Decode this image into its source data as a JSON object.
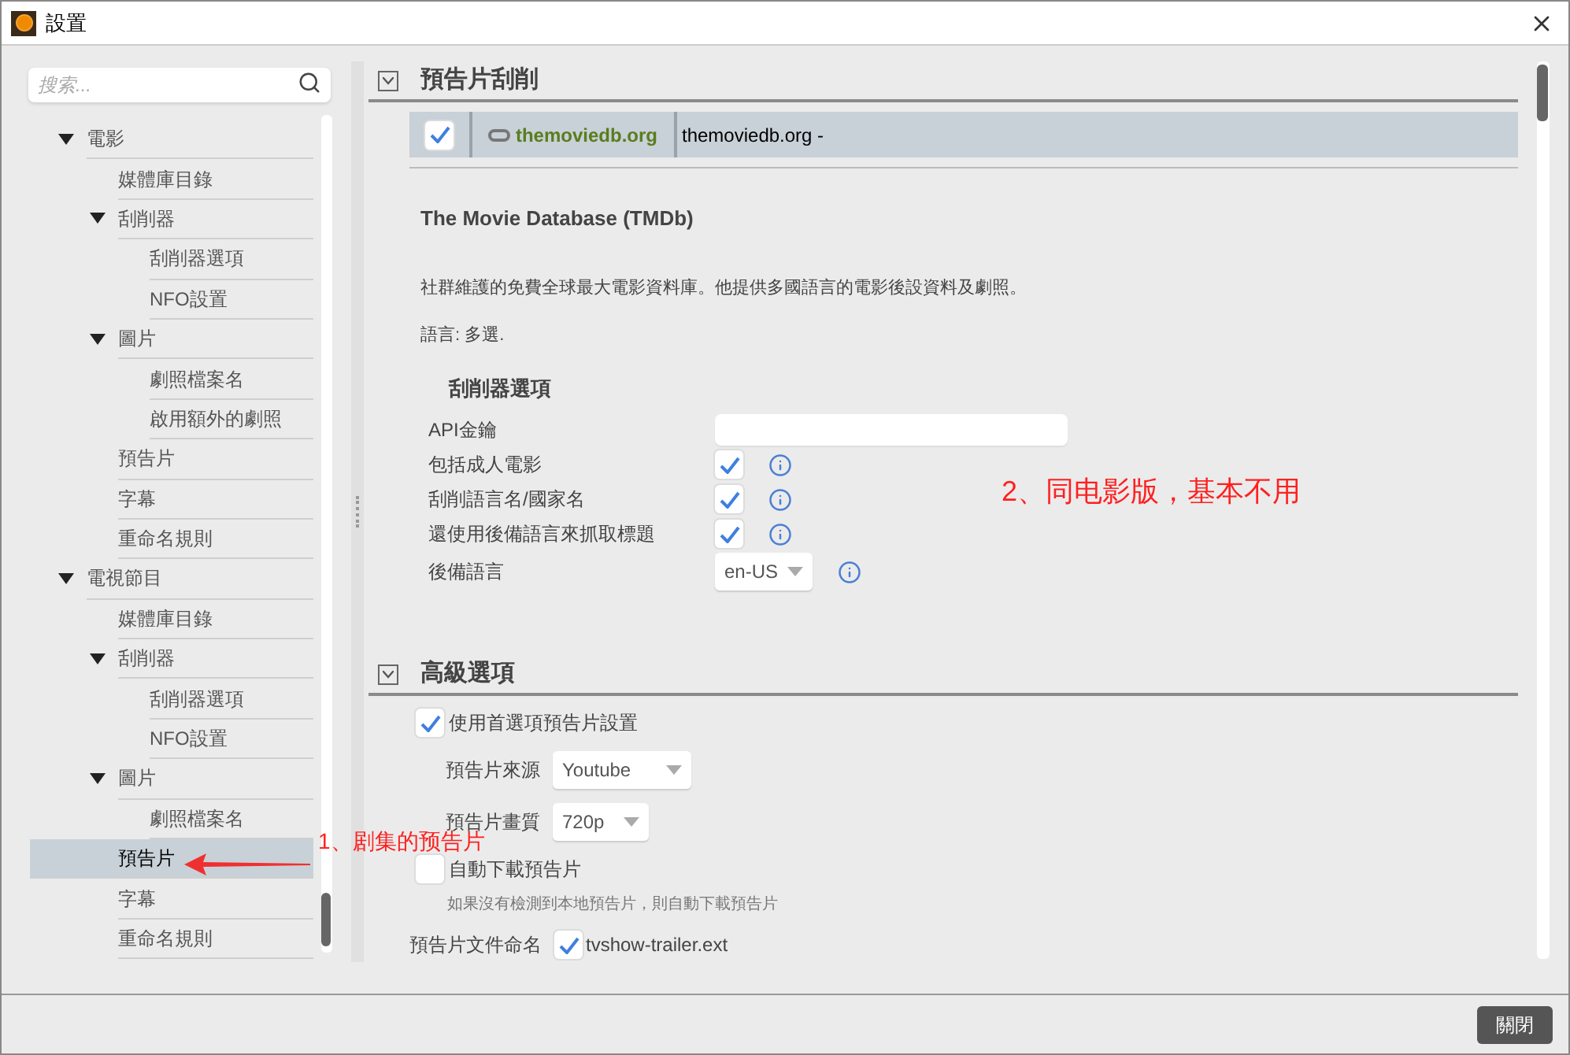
{
  "window": {
    "title": "設置"
  },
  "sidebar": {
    "search": {
      "placeholder": "搜索..."
    },
    "tree": [
      {
        "label": "電影",
        "expanded": true,
        "selected": false,
        "children": [
          {
            "label": "媒體庫目錄",
            "selected": false
          },
          {
            "label": "刮削器",
            "expanded": true,
            "selected": false,
            "children": [
              {
                "label": "刮削器選項",
                "selected": false
              },
              {
                "label": "NFO設置",
                "selected": false
              }
            ]
          },
          {
            "label": "圖片",
            "expanded": true,
            "selected": false,
            "children": [
              {
                "label": "劇照檔案名",
                "selected": false
              },
              {
                "label": "啟用額外的劇照",
                "selected": false
              }
            ]
          },
          {
            "label": "預告片",
            "selected": false
          },
          {
            "label": "字幕",
            "selected": false
          },
          {
            "label": "重命名規則",
            "selected": false
          }
        ]
      },
      {
        "label": "電視節目",
        "expanded": true,
        "selected": false,
        "children": [
          {
            "label": "媒體庫目錄",
            "selected": false
          },
          {
            "label": "刮削器",
            "expanded": true,
            "selected": false,
            "children": [
              {
                "label": "刮削器選項",
                "selected": false
              },
              {
                "label": "NFO設置",
                "selected": false
              }
            ]
          },
          {
            "label": "圖片",
            "expanded": true,
            "selected": false,
            "children": [
              {
                "label": "劇照檔案名",
                "selected": false
              }
            ]
          },
          {
            "label": "預告片",
            "selected": true
          },
          {
            "label": "字幕",
            "selected": false
          },
          {
            "label": "重命名規則",
            "selected": false
          }
        ]
      }
    ]
  },
  "sections": [
    {
      "kind": "scraper",
      "title": "預告片刮削",
      "expanded": true,
      "scraper": {
        "checked": true,
        "logo": "themoviedb.org",
        "name": "themoviedb.org -"
      },
      "heading": "The Movie Database (TMDb)",
      "description": "社群維護的免費全球最大電影資料庫。他提供多國語言的電影後設資料及劇照。",
      "languages": "語言: 多選.",
      "options_title": "刮削器選項",
      "options": [
        {
          "kind": "text",
          "label": "API金鑰"
        },
        {
          "kind": "checkbox",
          "label": "包括成人電影",
          "checked": true
        },
        {
          "kind": "checkbox",
          "label": "刮削語言名/國家名",
          "checked": true
        },
        {
          "kind": "checkbox",
          "label": "還使用後備語言來抓取標題",
          "checked": true
        },
        {
          "kind": "select",
          "label": "後備語言",
          "value": "en-US"
        }
      ]
    },
    {
      "kind": "advanced",
      "title": "高級選項",
      "expanded": true,
      "items": [
        {
          "kind": "check",
          "label": "使用首選項預告片設置",
          "checked": true
        },
        {
          "kind": "select",
          "label": "預告片來源",
          "value": "Youtube"
        },
        {
          "kind": "select",
          "label": "預告片畫質",
          "value": "720p"
        },
        {
          "kind": "check",
          "label": "自動下載預告片",
          "checked": false,
          "hint": "如果沒有檢測到本地預告片，則自動下載預告片"
        },
        {
          "kind": "naming",
          "label": "預告片文件命名",
          "checked": true,
          "value": "tvshow-trailer.ext"
        }
      ]
    }
  ],
  "annotations": [
    {
      "kind": "arrow",
      "text": "1、剧集的预告片"
    },
    {
      "kind": "note",
      "text": "2、同电影版，基本不用"
    }
  ],
  "footer": {
    "close_button": "關閉"
  }
}
